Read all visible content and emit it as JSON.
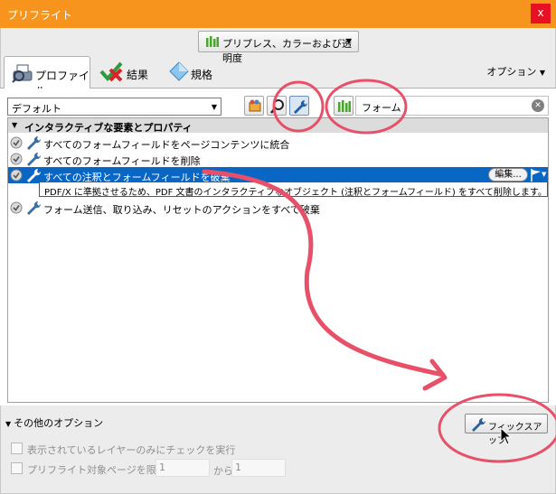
{
  "window": {
    "title": "プリフライト",
    "close_glyph": "x"
  },
  "profile_dropdown": {
    "label": "プリプレス、カラーおよび透明度",
    "icon": "bar-chart-icon"
  },
  "tabs": [
    {
      "label": "プロファイル",
      "icon": "preflight-icon",
      "active": true
    },
    {
      "label": "結果",
      "icon": "check-cross-icon"
    },
    {
      "label": "規格",
      "icon": "standards-diamond-icon"
    }
  ],
  "options_label": "オプション",
  "library_combo": {
    "value": "デフォルト"
  },
  "search": {
    "value": "フォーム"
  },
  "tree": {
    "category": "インタラクティブな要素とプロパティ",
    "rows": [
      {
        "label": "すべてのフォームフィールドをページコンテンツに統合"
      },
      {
        "label": "すべてのフォームフィールドを削除"
      },
      {
        "label": "すべての注釈とフォームフィールドを破棄",
        "selected": true
      },
      {
        "label": "フォーム送信、取り込み、リセットのアクションをすべて破棄"
      }
    ],
    "selected_description": "PDF/X に準拠させるため、PDF 文書のインタラクティブなオブジェクト (注釈とフォームフィールド) をすべて削除します。",
    "edit_label": "編集..."
  },
  "more_options_label": "その他のオプション",
  "fixup_label": "フィックスアップ",
  "options": {
    "layers_only_label": "表示されているレイヤーのみにチェックを実行",
    "limit_pages_label": "プリフライト対象ページを限定：",
    "page_from": "1",
    "page_to_label": "から",
    "page_to": "1"
  },
  "colors": {
    "titlebar": "#f7941d",
    "selection": "#0a66c4",
    "annotation": "#e8506a"
  }
}
